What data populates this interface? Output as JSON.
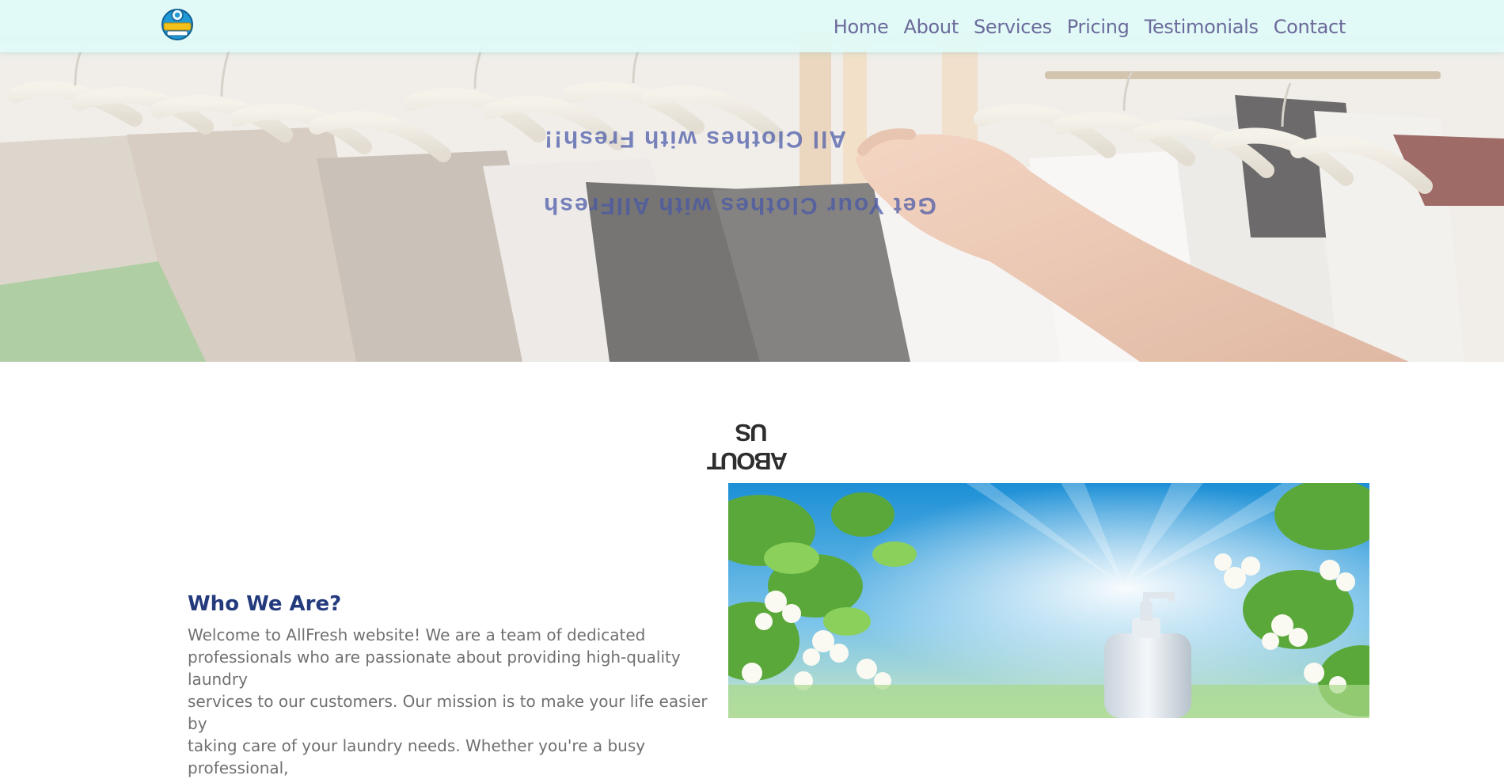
{
  "navbar": {
    "logo_alt": "AllFresh Laundry logo",
    "links": [
      {
        "label": "Home"
      },
      {
        "label": "About"
      },
      {
        "label": "Services"
      },
      {
        "label": "Pricing"
      },
      {
        "label": "Testimonials"
      },
      {
        "label": "Contact"
      }
    ]
  },
  "hero": {
    "title": "All Clothes with Fresh!!",
    "subtitle": "Get Your Clothes with AllFresh",
    "image_description": "clothes on hangers on a rack with a hand"
  },
  "about": {
    "heading": "ABOUT US",
    "subtitle": "Who We Are?",
    "body_lines": [
      "Welcome to AllFresh website! We are a team of dedicated",
      "professionals who are passionate about providing high-quality laundry",
      "services to our customers. Our mission is to make your life easier by",
      "taking care of your laundry needs. Whether you're a busy professional,"
    ],
    "image_description": "detergent bottle among white blossoms and sunlight"
  },
  "colors": {
    "nav_text": "#6c6a9a",
    "hero_text": "#4658a8",
    "subtitle": "#233a7c",
    "body_text": "#707070",
    "navbar_bg": "#defcfa"
  }
}
